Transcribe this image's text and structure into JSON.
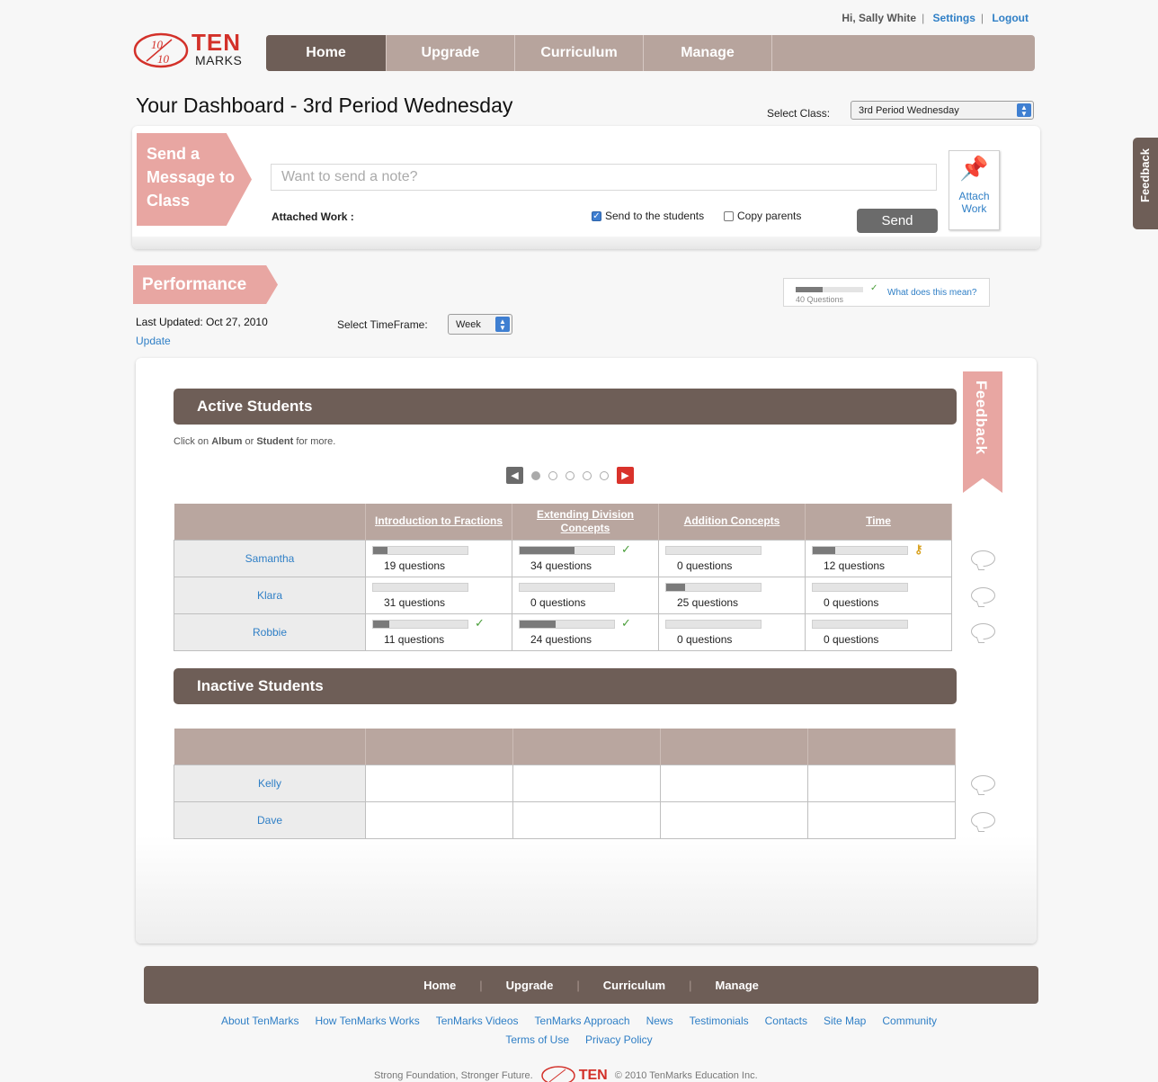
{
  "header": {
    "greeting": "Hi, Sally White",
    "settings": "Settings",
    "logout": "Logout",
    "logo_ten": "TEN",
    "logo_marks": "MARKS",
    "logo_fraction": "10/10"
  },
  "nav": {
    "tabs": [
      "Home",
      "Upgrade",
      "Curriculum",
      "Manage"
    ],
    "active": "Home"
  },
  "dashboard": {
    "title": "Your Dashboard - 3rd Period Wednesday",
    "select_class_label": "Select Class:",
    "select_class_value": "3rd Period Wednesday"
  },
  "message": {
    "banner": "Send a Message to Class",
    "placeholder": "Want to send a note?",
    "attached_label": "Attached Work :",
    "send_students": "Send to the students",
    "send_students_checked": true,
    "copy_parents": "Copy parents",
    "copy_parents_checked": false,
    "send_button": "Send",
    "attach_button": "Attach Work"
  },
  "performance": {
    "banner": "Performance",
    "last_updated": "Last Updated: Oct 27, 2010",
    "update_link": "Update",
    "timeframe_label": "Select TimeFrame:",
    "timeframe_value": "Week",
    "legend_count": "40 Questions",
    "legend_link": "What does this mean?",
    "legend_fill": 0.4
  },
  "active": {
    "title": "Active Students",
    "hint_prefix": "Click on",
    "hint_album": "Album",
    "hint_or": "or",
    "hint_student": "Student",
    "hint_suffix": "for more.",
    "pager_pages": 5,
    "pager_current": 1,
    "columns": [
      "Introduction to Fractions",
      "Extending Division Concepts",
      "Addition Concepts",
      "Time"
    ],
    "rows": [
      {
        "name": "Samantha",
        "cells": [
          {
            "questions": "19 questions",
            "progress": 0.15,
            "mark": ""
          },
          {
            "questions": "34 questions",
            "progress": 0.58,
            "mark": "check"
          },
          {
            "questions": "0 questions",
            "progress": 0,
            "mark": ""
          },
          {
            "questions": "12 questions",
            "progress": 0.24,
            "mark": "key"
          }
        ]
      },
      {
        "name": "Klara",
        "cells": [
          {
            "questions": "31 questions",
            "progress": 0,
            "mark": ""
          },
          {
            "questions": "0 questions",
            "progress": 0,
            "mark": ""
          },
          {
            "questions": "25 questions",
            "progress": 0.2,
            "mark": ""
          },
          {
            "questions": "0 questions",
            "progress": 0,
            "mark": ""
          }
        ]
      },
      {
        "name": "Robbie",
        "cells": [
          {
            "questions": "11 questions",
            "progress": 0.17,
            "mark": "check"
          },
          {
            "questions": "24 questions",
            "progress": 0.38,
            "mark": "check"
          },
          {
            "questions": "0 questions",
            "progress": 0,
            "mark": ""
          },
          {
            "questions": "0 questions",
            "progress": 0,
            "mark": ""
          }
        ]
      }
    ]
  },
  "inactive": {
    "title": "Inactive Students",
    "rows": [
      "Kelly",
      "Dave"
    ]
  },
  "feedback_flag": "Feedback",
  "side_feedback": "Feedback",
  "footer": {
    "nav": [
      "Home",
      "Upgrade",
      "Curriculum",
      "Manage"
    ],
    "links": [
      "About TenMarks",
      "How TenMarks Works",
      "TenMarks Videos",
      "TenMarks Approach",
      "News",
      "Testimonials",
      "Contacts",
      "Site Map",
      "Community"
    ],
    "links2": [
      "Terms of Use",
      "Privacy Policy"
    ],
    "tagline": "Strong Foundation, Stronger Future.",
    "logo_ten": "TEN",
    "copyright": "© 2010 TenMarks Education Inc."
  },
  "colors": {
    "brand_red": "#d3312a",
    "nav_brown": "#6e5e57",
    "nav_taupe": "#b7a49d",
    "banner_pink": "#e8a6a2",
    "link_blue": "#2f7fc6"
  }
}
